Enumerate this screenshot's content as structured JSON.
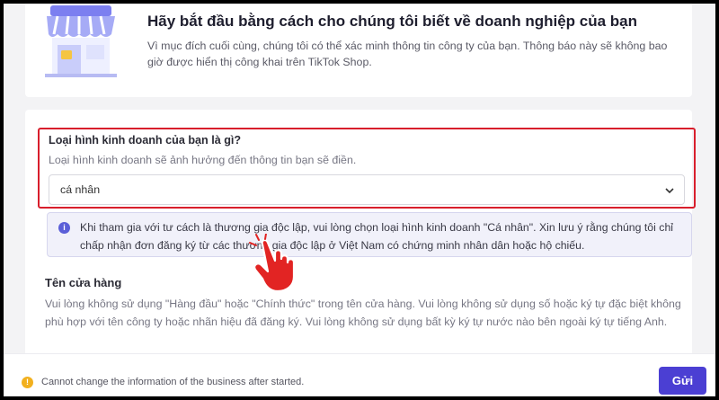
{
  "header": {
    "title": "Hãy bắt đầu bằng cách cho chúng tôi biết về doanh nghiệp của bạn",
    "description": "Vì mục đích cuối cùng, chúng tôi có thể xác minh thông tin công ty của bạn. Thông báo này sẽ không bao giờ được hiển thị công khai trên TikTok Shop.",
    "illustration_icon": "storefront-icon"
  },
  "business_type": {
    "label": "Loại hình kinh doanh của bạn là gì?",
    "hint": "Loại hình kinh doanh sẽ ảnh hưởng đến thông tin bạn sẽ điền.",
    "selected_value": "cá nhân",
    "dropdown_icon": "chevron-down-icon"
  },
  "info_notice": {
    "icon": "info-icon",
    "text": "Khi tham gia với tư cách là thương gia độc lập, vui lòng chọn loại hình kinh doanh \"Cá nhân\". Xin lưu ý rằng chúng tôi chỉ chấp nhận đơn đăng ký từ các thương gia độc lập ở Việt Nam có chứng minh nhân dân hoặc hộ chiếu."
  },
  "store_name": {
    "label": "Tên cửa hàng",
    "description": "Vui lòng không sử dụng \"Hàng đầu\" hoặc \"Chính thức\" trong tên cửa hàng. Vui lòng không sử dụng số hoặc ký tự đặc biệt không phù hợp với tên công ty hoặc nhãn hiệu đã đăng ký. Vui lòng không sử dụng bất kỳ ký tự nước nào bên ngoài ký tự tiếng Anh."
  },
  "footer": {
    "warning_icon": "warning-icon",
    "warning_text": "Cannot change the information of the business after started.",
    "submit_label": "Gửi"
  },
  "overlay": {
    "icon": "pointing-hand-icon"
  },
  "colors": {
    "accent": "#4b3fd3",
    "highlight_border": "#d81e2c",
    "warning": "#f2b01e",
    "info": "#5b5fd8"
  }
}
